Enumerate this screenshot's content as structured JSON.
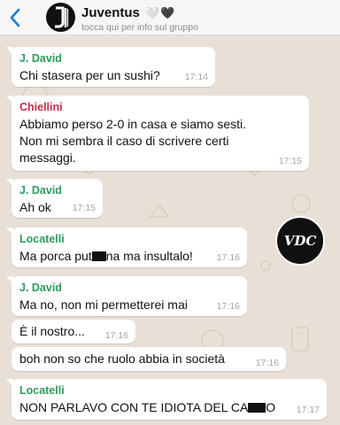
{
  "header": {
    "back_icon": "chevron-left-icon",
    "avatar_icon": "juventus-logo-icon",
    "title": "Juventus",
    "title_emoji": "🤍🖤",
    "subtitle": "tocca qui per info sul gruppo"
  },
  "colors": {
    "accent": "#1a7dd7",
    "sender_green": "#2e9b5c",
    "sender_red": "#c0304a",
    "bubble": "#ffffff",
    "chat_bg": "#e8e0d6"
  },
  "watermark": {
    "label": "VDC"
  },
  "messages": [
    {
      "sender": "J. David",
      "text": "Chi stasera per un sushi?",
      "time": "17:14"
    },
    {
      "sender": "Chiellini",
      "text": "Abbiamo perso 2-0 in casa e siamo sesti.\nNon mi sembra il caso di scrivere certi\nmessaggi.",
      "time": "17:15"
    },
    {
      "sender": "J. David",
      "text": "Ah ok",
      "time": "17:15"
    },
    {
      "sender": "Locatelli",
      "text_before": "Ma porca put",
      "text_after": "na ma insultalo!",
      "time": "17:16"
    },
    {
      "sender": "J. David",
      "text": "Ma no, non mi permetterei mai",
      "time": "17:16"
    },
    {
      "text": "È il nostro...",
      "time": "17:16"
    },
    {
      "text": "boh non so che ruolo abbia in società",
      "time": "17:16"
    },
    {
      "sender": "Locatelli",
      "text_before": "NON PARLAVO CON TE IDIOTA DEL CA",
      "text_after": "O",
      "time": "17:17"
    }
  ]
}
